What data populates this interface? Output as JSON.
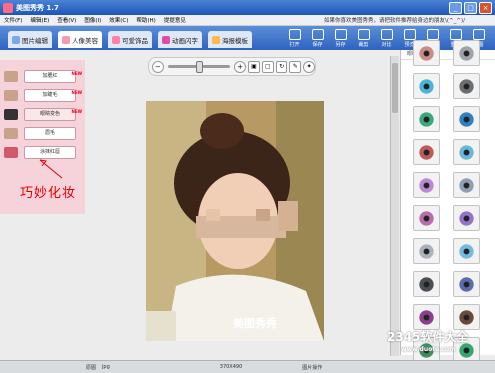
{
  "window": {
    "title": "美图秀秀 1.7",
    "close_glyph": "×",
    "min_glyph": "_",
    "max_glyph": "□"
  },
  "menubar": {
    "items": [
      "文件(F)",
      "编辑(E)",
      "查看(V)",
      "图像(I)",
      "效果(C)",
      "帮助(H)",
      "提提意见"
    ],
    "ad_text": "如果你喜欢美图秀秀，请把软件推荐给身边的朋友\\(^_^)/"
  },
  "tabs": [
    {
      "label": "图片编辑"
    },
    {
      "label": "人像美容"
    },
    {
      "label": "可爱饰品"
    },
    {
      "label": "动画闪字"
    },
    {
      "label": "海报模板"
    }
  ],
  "toolbar": [
    "打开",
    "保存",
    "另存",
    "裁剪",
    "对比",
    "预览",
    "撤销",
    "重做",
    "原图"
  ],
  "left_panel": {
    "items": [
      {
        "label": "加腮红",
        "new_tag": "NEW"
      },
      {
        "label": "加睫毛",
        "new_tag": "NEW"
      },
      {
        "label": "眼睛变色",
        "new_tag": "NEW"
      },
      {
        "label": "眉毛",
        "new_tag": ""
      },
      {
        "label": "涂抹红唇",
        "new_tag": ""
      }
    ],
    "annotation": "巧妙化妆"
  },
  "zoom": {
    "minus": "−",
    "plus": "+"
  },
  "photo": {
    "watermark": "美图秀秀"
  },
  "right_panel": {
    "header": "眼睛",
    "swatch_colors": [
      "#c98c86",
      "#9fa3a8",
      "#4ab6d7",
      "#6b6f72",
      "#3aa87c",
      "#2f7fc2",
      "#c05b5c",
      "#67b8d9",
      "#b98ad0",
      "#8e9fb3",
      "#b86fa9",
      "#9474c9",
      "#a9b2bd",
      "#76b9e0",
      "#4a4e55",
      "#5b6cae",
      "#8b3f8d",
      "#6a4a3d",
      "#3d8e62",
      "#34a870"
    ]
  },
  "status": {
    "left": "原图",
    "filename": "jpg",
    "size": "370X490",
    "right": "图片操作"
  },
  "watermark": {
    "text": "2345软件大全",
    "url": "www.duote.com"
  }
}
